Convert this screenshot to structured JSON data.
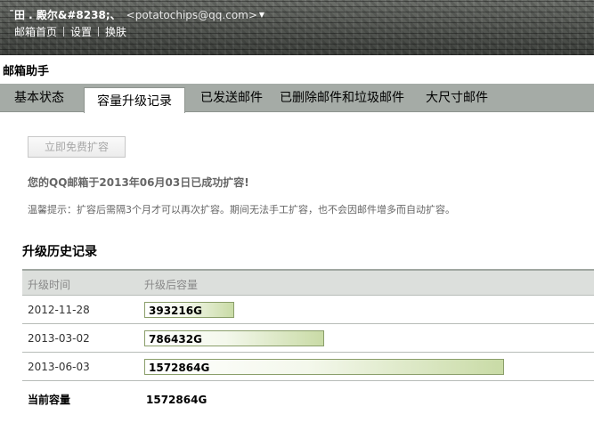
{
  "header": {
    "user_name": "¯田 . 殿尔&#8238;、",
    "user_email": "<potatochips@qq.com>",
    "nav": [
      "邮箱首页",
      "设置",
      "换肤"
    ]
  },
  "page_title": "邮箱助手",
  "tabs": [
    {
      "label": "基本状态",
      "active": false
    },
    {
      "label": "容量升级记录",
      "active": true
    },
    {
      "label": "已发送邮件",
      "active": false
    },
    {
      "label": "已删除邮件和垃圾邮件",
      "active": false
    },
    {
      "label": "大尺寸邮件",
      "active": false
    }
  ],
  "content": {
    "expand_button": "立即免费扩容",
    "success_message": "您的QQ邮箱于2013年06月03日已成功扩容!",
    "tip_message": "温馨提示：扩容后需隔3个月才可以再次扩容。期间无法手工扩容，也不会因邮件增多而自动扩容。"
  },
  "history": {
    "title": "升级历史记录",
    "columns": [
      "升级时间",
      "升级后容量"
    ],
    "max_capacity": 1572864,
    "rows": [
      {
        "date": "2012-11-28",
        "capacity": 393216,
        "label": "393216G"
      },
      {
        "date": "2013-03-02",
        "capacity": 786432,
        "label": "786432G"
      },
      {
        "date": "2013-06-03",
        "capacity": 1572864,
        "label": "1572864G"
      }
    ],
    "current_label": "当前容量",
    "current_value": "1572864G"
  },
  "colors": {
    "bar_end": "#c9dba6",
    "bar_border": "#8a9e6a",
    "tabbar_bg": "#a5aba6"
  }
}
